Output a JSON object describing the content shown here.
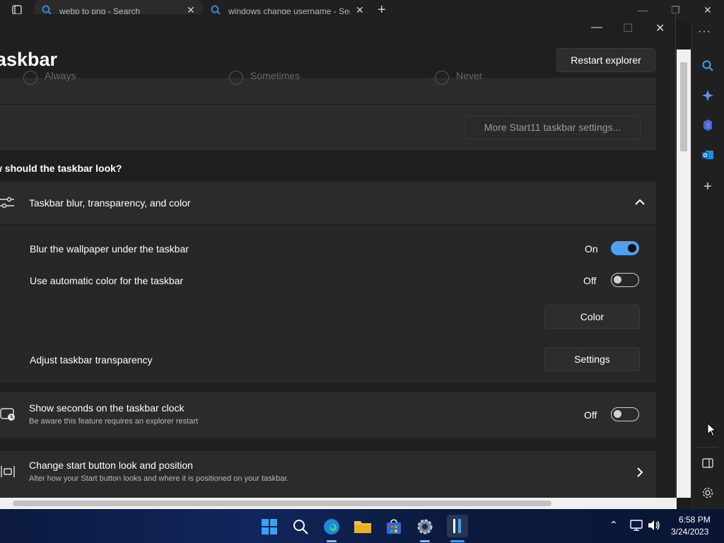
{
  "browser": {
    "tabs": [
      {
        "label": "webp to png - Search"
      },
      {
        "label": "windows change username - Sea"
      }
    ]
  },
  "app": {
    "title": "askbar",
    "restart_button": "Restart explorer",
    "radio_options": [
      "Always",
      "Sometimes",
      "Never"
    ],
    "more_settings_button": "More Start11 taskbar settings...",
    "section_heading": "w should the taskbar look?",
    "expander": {
      "label": "Taskbar blur, transparency, and color"
    },
    "blur_row": {
      "label": "Blur the wallpaper under the taskbar",
      "state": "On",
      "toggle": "on"
    },
    "autocolor_row": {
      "label": "Use automatic color for the taskbar",
      "state": "Off",
      "toggle": "off"
    },
    "color_button": "Color",
    "transparency_row": {
      "label": "Adjust taskbar transparency",
      "button": "Settings"
    },
    "seconds_row": {
      "label": "Show seconds on the taskbar clock",
      "sub": "Be aware this feature requires an explorer restart",
      "state": "Off",
      "toggle": "off"
    },
    "startbutton_row": {
      "label": "Change start button look and position",
      "sub": "Alter how your Start button looks and where it is positioned on your taskbar."
    }
  },
  "taskbar": {
    "time": "6:58 PM",
    "date": "3/24/2023"
  },
  "colors": {
    "accent": "#4ea1ea",
    "card": "#2b2b2b",
    "window": "#1f1f1f"
  }
}
